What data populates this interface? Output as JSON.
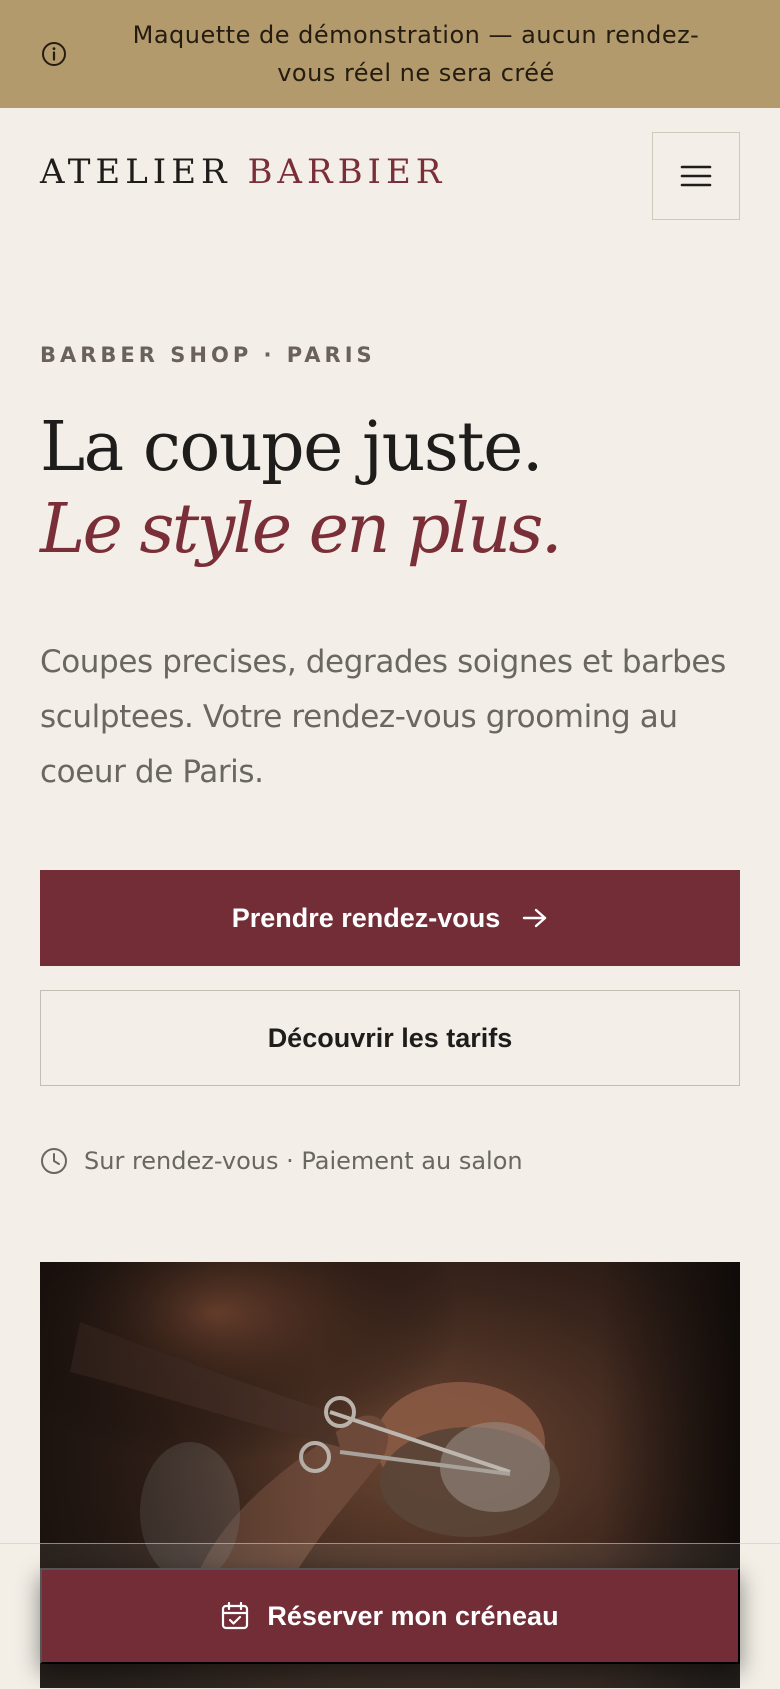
{
  "banner": {
    "icon": "info-circle-icon",
    "text": "Maquette de démonstration — aucun rendez-vous réel ne sera créé"
  },
  "header": {
    "logo_word_1": "ATELIER",
    "logo_word_2": "BARBIER",
    "menu_icon": "hamburger-menu-icon"
  },
  "hero": {
    "eyebrow": "BARBER SHOP · PARIS",
    "headline_line_1": "La coupe juste.",
    "headline_line_2": "Le style en plus.",
    "lede": "Coupes precises, degrades soignes et barbes sculptees. Votre rendez-vous grooming au coeur de Paris.",
    "primary_button": "Prendre rendez-vous",
    "primary_button_icon": "arrow-right-icon",
    "secondary_button": "Découvrir les tarifs",
    "note_icon": "clock-icon",
    "note": "Sur rendez-vous · Paiement au salon"
  },
  "sticky": {
    "button_label": "Réserver mon créneau",
    "button_icon": "calendar-check-icon"
  },
  "colors": {
    "background": "#f3efe8",
    "banner": "#b39a6c",
    "accent": "#722d37",
    "text": "#1f1d1b",
    "muted": "#6a6661"
  }
}
